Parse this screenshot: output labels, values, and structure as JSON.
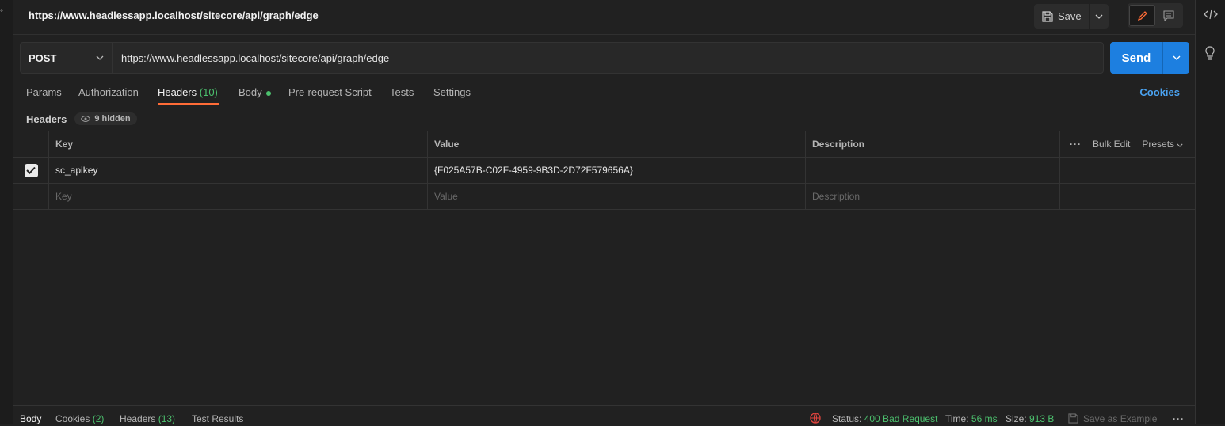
{
  "title": "https://www.headlessapp.localhost/sitecore/api/graph/edge",
  "toolbar": {
    "save_label": "Save"
  },
  "request": {
    "method": "POST",
    "url": "https://www.headlessapp.localhost/sitecore/api/graph/edge",
    "send_label": "Send"
  },
  "tabs": {
    "params": "Params",
    "authorization": "Authorization",
    "headers": "Headers",
    "headers_count": "(10)",
    "body": "Body",
    "prerequest": "Pre-request Script",
    "tests": "Tests",
    "settings": "Settings",
    "cookies": "Cookies"
  },
  "headers_section": {
    "label": "Headers",
    "hidden": "9 hidden"
  },
  "table": {
    "columns": {
      "key": "Key",
      "value": "Value",
      "description": "Description"
    },
    "actions": {
      "bulk_edit": "Bulk Edit",
      "presets": "Presets"
    },
    "rows": [
      {
        "checked": true,
        "key": "sc_apikey",
        "value": "{F025A57B-C02F-4959-9B3D-2D72F579656A}",
        "description": ""
      }
    ],
    "placeholders": {
      "key": "Key",
      "value": "Value",
      "description": "Description"
    }
  },
  "response": {
    "tabs": {
      "body": "Body",
      "cookies": "Cookies",
      "cookies_count": "(2)",
      "headers": "Headers",
      "headers_count": "(13)",
      "tests": "Test Results"
    },
    "status_label": "Status:",
    "status_value": "400 Bad Request",
    "time_label": "Time:",
    "time_value": "56 ms",
    "size_label": "Size:",
    "size_value": "913 B",
    "save_example": "Save as Example"
  },
  "colors": {
    "accent": "#ff6c37",
    "send": "#1d7fe0",
    "success": "#4cc16e",
    "link": "#4aa2f0"
  }
}
